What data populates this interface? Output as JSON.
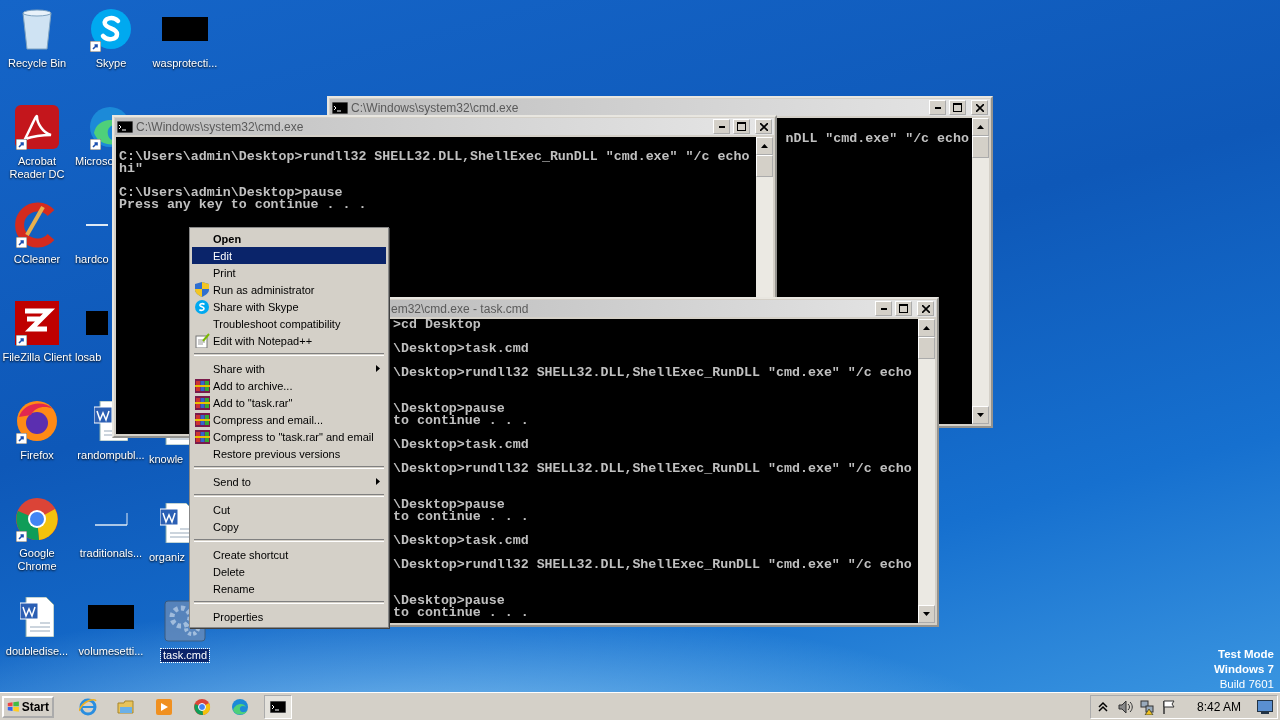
{
  "desktop": {
    "columns": [
      {
        "top": [
          {
            "label": "Recycle Bin",
            "kind": "recycle",
            "shortcut": false,
            "selected": false,
            "clipped": false
          },
          {
            "label": "Acrobat Reader DC",
            "kind": "acrobat",
            "shortcut": true,
            "selected": false,
            "clipped": false
          },
          {
            "label": "CCleaner",
            "kind": "ccleaner",
            "shortcut": true,
            "selected": false,
            "clipped": false
          },
          {
            "label": "FileZilla Client",
            "kind": "filezilla",
            "shortcut": true,
            "selected": false,
            "clipped": false
          },
          {
            "label": "Firefox",
            "kind": "firefox",
            "shortcut": true,
            "selected": false,
            "clipped": false
          },
          {
            "label": "Google Chrome",
            "kind": "chrome",
            "shortcut": true,
            "selected": false,
            "clipped": false
          },
          {
            "label": "doubledise...",
            "kind": "word",
            "shortcut": false,
            "selected": false,
            "clipped": false
          }
        ]
      },
      {
        "top": [
          {
            "label": "Skype",
            "kind": "skype",
            "shortcut": true,
            "selected": false,
            "clipped": false
          },
          {
            "label": "Microso",
            "kind": "edge",
            "shortcut": true,
            "selected": false,
            "clipped": true
          },
          {
            "label": "hardco",
            "kind": "blank",
            "shortcut": false,
            "selected": false,
            "clipped": true
          },
          {
            "label": "losab",
            "kind": "dark",
            "shortcut": false,
            "selected": false,
            "clipped": true
          },
          {
            "label": "randompubl...",
            "kind": "word",
            "shortcut": false,
            "selected": false,
            "clipped": false
          },
          {
            "label": "traditionals...",
            "kind": "blank",
            "shortcut": false,
            "selected": false,
            "clipped": false
          },
          {
            "label": "volumesetti...",
            "kind": "dark",
            "shortcut": false,
            "selected": false,
            "clipped": false
          }
        ]
      },
      {
        "top": [
          {
            "label": "wasprotecti...",
            "kind": "dark",
            "shortcut": false,
            "selected": false,
            "clipped": false
          }
        ],
        "bottom": [
          {
            "label": "knowle",
            "kind": "word",
            "shortcut": false,
            "selected": false,
            "clipped": true
          },
          {
            "label": "organiz",
            "kind": "word",
            "shortcut": false,
            "selected": false,
            "clipped": true
          },
          {
            "label": "task.cmd",
            "kind": "gear",
            "shortcut": false,
            "selected": true,
            "clipped": false
          }
        ]
      }
    ]
  },
  "windows": [
    {
      "title": "C:\\Windows\\system32\\cmd.exe",
      "title_icon": true,
      "blocks": [
        [
          {
            "text": "nDLL \"cmd.exe\" \"/c echo",
            "wrapped": false
          }
        ]
      ]
    },
    {
      "title": "C:\\Windows\\system32\\cmd.exe",
      "title_icon": true,
      "blocks": [
        [
          {
            "text": "C:\\Users\\admin\\Desktop>rundll32 SHELL32.DLL,ShellExec_RunDLL \"cmd.exe\" \"/c echo",
            "wrapped": false
          },
          {
            "text": "hi\"",
            "wrapped": false
          }
        ],
        [
          {
            "text": "C:\\Users\\admin\\Desktop>pause",
            "wrapped": false
          },
          {
            "text": "Press any key to continue . . .",
            "wrapped": false
          }
        ]
      ]
    },
    {
      "title": "em32\\cmd.exe - task.cmd",
      "title_icon": false,
      "blocks": [
        [
          {
            "text": ">cd Desktop",
            "wrapped": false
          }
        ],
        [
          {
            "text": "\\Desktop>task.cmd",
            "wrapped": false
          }
        ],
        [
          {
            "text": "\\Desktop>rundll32 SHELL32.DLL,ShellExec_RunDLL \"cmd.exe\" \"/c echo",
            "wrapped": true
          }
        ],
        [
          {
            "text": "\\Desktop>pause",
            "wrapped": false
          },
          {
            "text": "to continue . . .",
            "wrapped": false
          }
        ],
        [
          {
            "text": "\\Desktop>task.cmd",
            "wrapped": false
          }
        ],
        [
          {
            "text": "\\Desktop>rundll32 SHELL32.DLL,ShellExec_RunDLL \"cmd.exe\" \"/c echo",
            "wrapped": true
          }
        ],
        [
          {
            "text": "\\Desktop>pause",
            "wrapped": false
          },
          {
            "text": "to continue . . .",
            "wrapped": false
          }
        ],
        [
          {
            "text": "\\Desktop>task.cmd",
            "wrapped": false
          }
        ],
        [
          {
            "text": "\\Desktop>rundll32 SHELL32.DLL,ShellExec_RunDLL \"cmd.exe\" \"/c echo",
            "wrapped": true
          }
        ],
        [
          {
            "text": "\\Desktop>pause",
            "wrapped": false
          },
          {
            "text": "to continue . . .",
            "wrapped": false
          }
        ]
      ]
    }
  ],
  "context_menu": {
    "items": [
      {
        "kind": "plain",
        "label": "Open",
        "default": true,
        "submenu": false,
        "selected": false
      },
      {
        "kind": "plain",
        "label": "Edit",
        "default": false,
        "submenu": false,
        "selected": true
      },
      {
        "kind": "plain",
        "label": "Print",
        "default": false,
        "submenu": false,
        "selected": false
      },
      {
        "kind": "shield",
        "label": "Run as administrator",
        "default": false,
        "submenu": false,
        "selected": false
      },
      {
        "kind": "skype",
        "label": "Share with Skype",
        "default": false,
        "submenu": false,
        "selected": false
      },
      {
        "kind": "plain",
        "label": "Troubleshoot compatibility",
        "default": false,
        "submenu": false,
        "selected": false
      },
      {
        "kind": "notepad",
        "label": "Edit with Notepad++",
        "default": false,
        "submenu": false,
        "selected": false
      },
      {
        "kind": "separator"
      },
      {
        "kind": "plain",
        "label": "Share with",
        "default": false,
        "submenu": true,
        "selected": false
      },
      {
        "kind": "archive",
        "label": "Add to archive...",
        "default": false,
        "submenu": false,
        "selected": false
      },
      {
        "kind": "archive",
        "label": "Add to \"task.rar\"",
        "default": false,
        "submenu": false,
        "selected": false
      },
      {
        "kind": "archive",
        "label": "Compress and email...",
        "default": false,
        "submenu": false,
        "selected": false
      },
      {
        "kind": "archive",
        "label": "Compress to \"task.rar\" and email",
        "default": false,
        "submenu": false,
        "selected": false
      },
      {
        "kind": "plain",
        "label": "Restore previous versions",
        "default": false,
        "submenu": false,
        "selected": false
      },
      {
        "kind": "separator"
      },
      {
        "kind": "plain",
        "label": "Send to",
        "default": false,
        "submenu": true,
        "selected": false
      },
      {
        "kind": "separator"
      },
      {
        "kind": "plain",
        "label": "Cut",
        "default": false,
        "submenu": false,
        "selected": false
      },
      {
        "kind": "plain",
        "label": "Copy",
        "default": false,
        "submenu": false,
        "selected": false
      },
      {
        "kind": "separator"
      },
      {
        "kind": "plain",
        "label": "Create shortcut",
        "default": false,
        "submenu": false,
        "selected": false
      },
      {
        "kind": "plain",
        "label": "Delete",
        "default": false,
        "submenu": false,
        "selected": false
      },
      {
        "kind": "plain",
        "label": "Rename",
        "default": false,
        "submenu": false,
        "selected": false
      },
      {
        "kind": "separator"
      },
      {
        "kind": "plain",
        "label": "Properties",
        "default": false,
        "submenu": false,
        "selected": false
      }
    ]
  },
  "system_notice": [
    {
      "text": "Test Mode",
      "bold": true
    },
    {
      "text": "Windows 7",
      "bold": true
    },
    {
      "text": "Build 7601",
      "bold": false
    }
  ],
  "taskbar": {
    "start": "Start",
    "apps": [
      {
        "kind": "ie",
        "active": false
      },
      {
        "kind": "folder",
        "active": false
      },
      {
        "kind": "media",
        "active": false
      },
      {
        "kind": "chrome",
        "active": false
      },
      {
        "kind": "edge",
        "active": false
      },
      {
        "kind": "cmd",
        "active": true
      }
    ],
    "tray": [
      {
        "kind": "chevron"
      },
      {
        "kind": "volume"
      },
      {
        "kind": "network"
      },
      {
        "kind": "flag"
      }
    ],
    "clock": "8:42 AM"
  }
}
